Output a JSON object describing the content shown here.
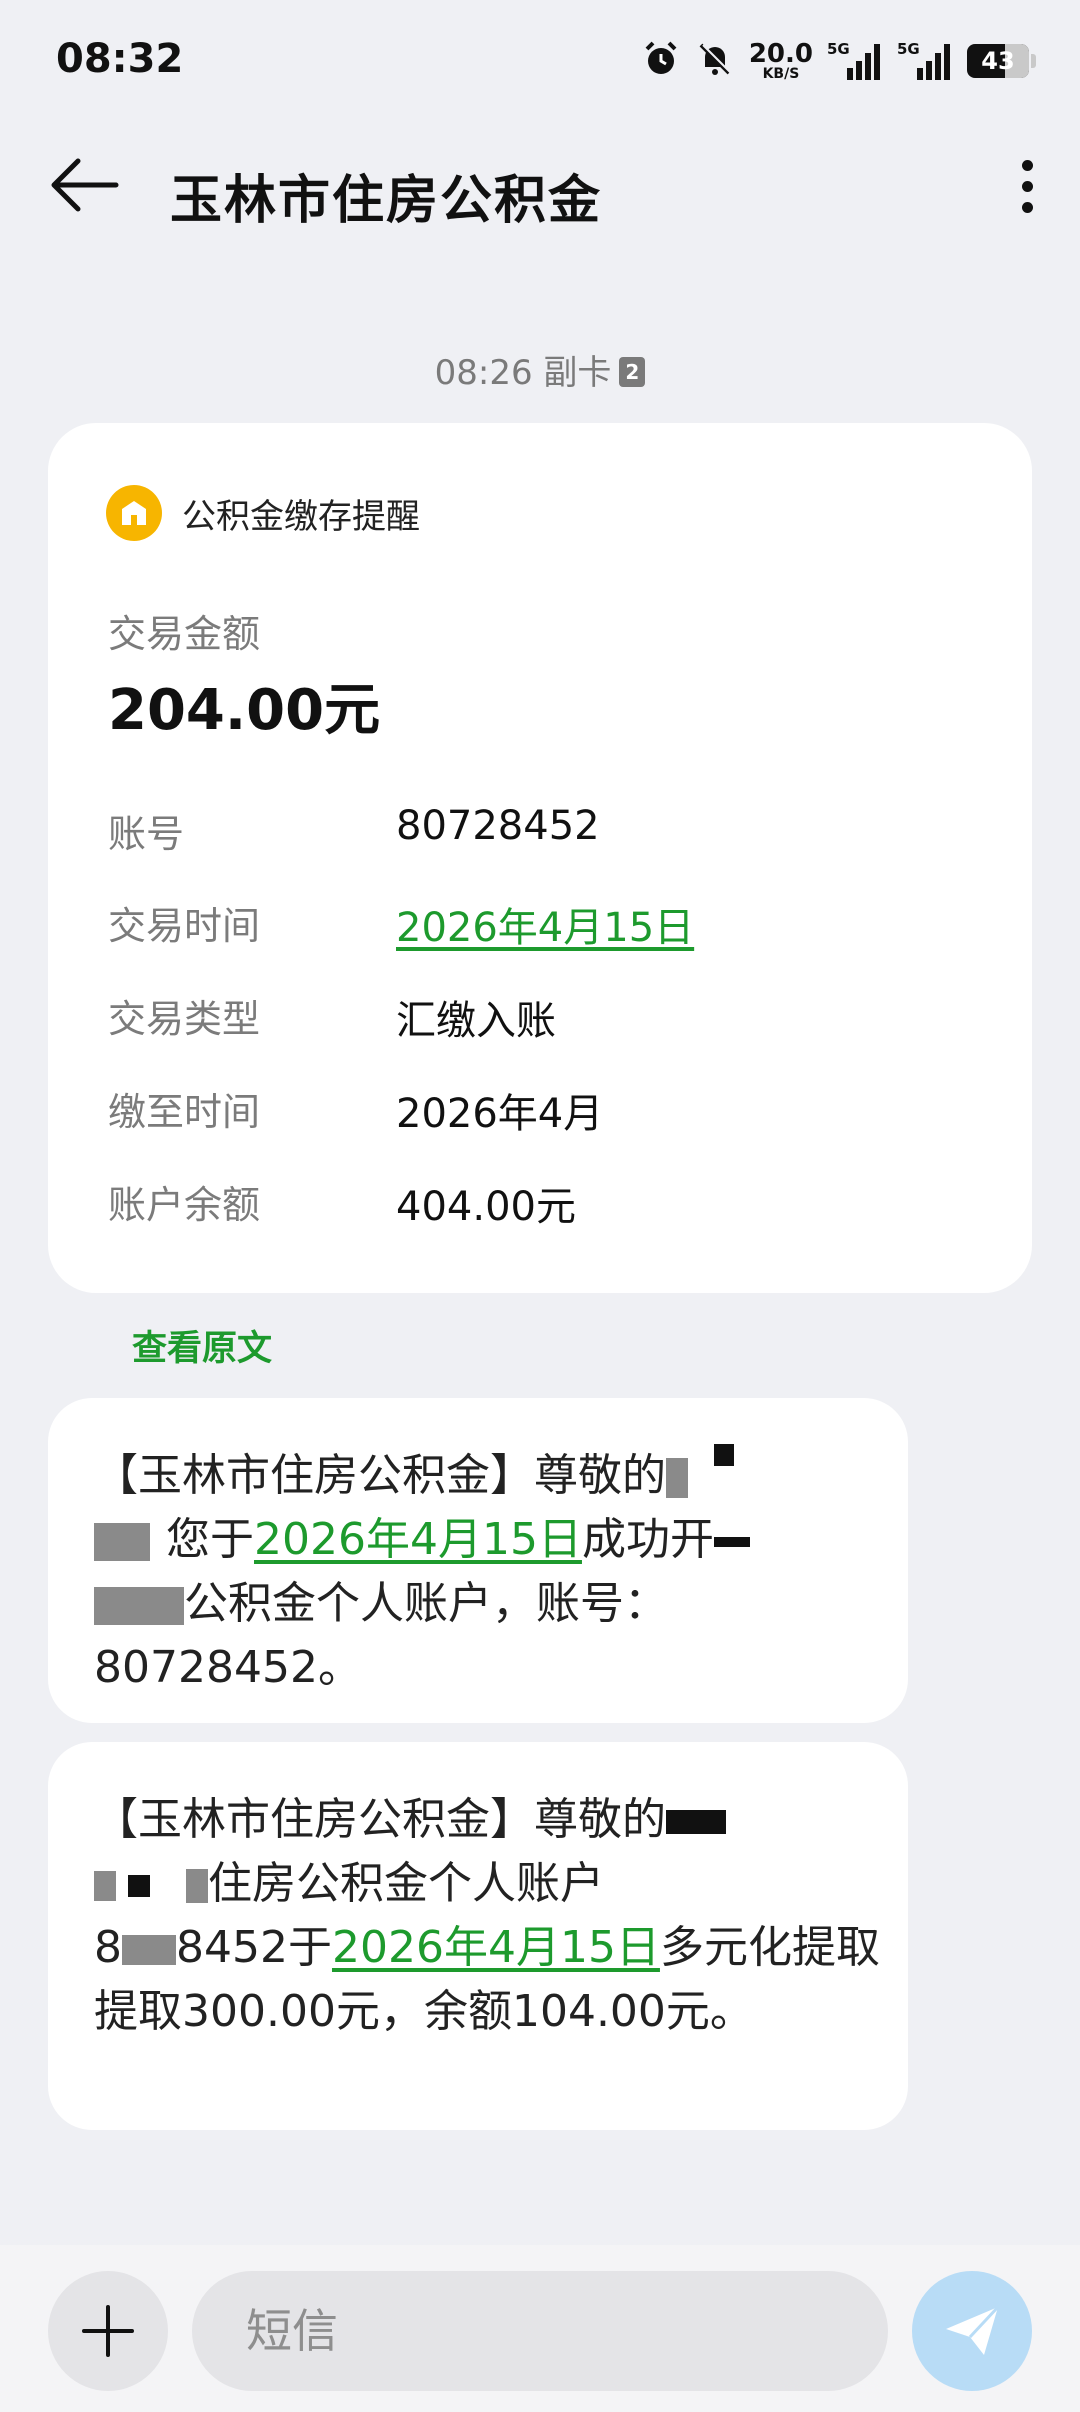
{
  "status_bar": {
    "time": "08:32",
    "net_speed": "20.0",
    "net_unit": "KB/S",
    "sim1_label": "5G",
    "sim2_label": "5G",
    "battery": "43"
  },
  "header": {
    "title": "玉林市住房公积金"
  },
  "message_meta": {
    "time": "08:26",
    "sim": "副卡",
    "sim_badge": "2"
  },
  "card": {
    "heading": "公积金缴存提醒",
    "amount_label": "交易金额",
    "amount_value": "204.00元",
    "rows": [
      {
        "label": "账号",
        "value": "80728452"
      },
      {
        "label": "交易时间",
        "value": "2026年4月15日"
      },
      {
        "label": "交易类型",
        "value": "汇缴入账"
      },
      {
        "label": "缴至时间",
        "value": "2026年4月"
      },
      {
        "label": "账户余额",
        "value": "404.00元"
      }
    ]
  },
  "view_original": "查看原文",
  "messages": [
    {
      "p1": "【玉林市住房公积金】尊敬的",
      "p2": "您于",
      "date": "2026年4月15日",
      "p3": "成功开",
      "p4": "公积金个人账户，账号：",
      "p5": "80728452。"
    },
    {
      "p1": "【玉林市住房公积金】尊敬的",
      "p2": "住房公积金个人账户",
      "p3": "8",
      "p4": "8452于",
      "date": "2026年4月15日",
      "p5": "多元化提取提取300.00元，余额104.00元。"
    }
  ],
  "composer": {
    "placeholder": "短信"
  },
  "colors": {
    "accent_green": "#1d9a2d",
    "badge_yellow": "#f7b500",
    "send_blue": "#b8dcf6"
  }
}
